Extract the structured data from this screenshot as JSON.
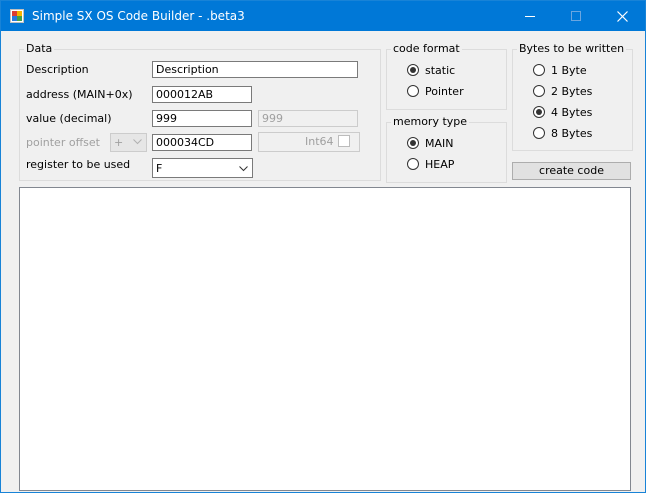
{
  "window": {
    "title": "Simple SX OS Code Builder - .beta3"
  },
  "data_group": {
    "title": "Data",
    "description_label": "Description",
    "description_value": "Description",
    "address_label": "address (MAIN+0x)",
    "address_value": "000012AB",
    "value_label": "value (decimal)",
    "value_value": "999",
    "value_secondary": "999",
    "pointer_offset_label": "pointer offset",
    "pointer_sign": "+",
    "pointer_offset_value": "000034CD",
    "int64_label": "Int64",
    "register_label": "register to be used",
    "register_value": "F"
  },
  "code_format": {
    "title": "code format",
    "options": [
      "static",
      "Pointer"
    ],
    "selected": "static"
  },
  "memory_type": {
    "title": "memory type",
    "options": [
      "MAIN",
      "HEAP"
    ],
    "selected": "MAIN"
  },
  "bytes_group": {
    "title": "Bytes to be written",
    "options": [
      "1 Byte",
      "2 Bytes",
      "4 Bytes",
      "8 Bytes"
    ],
    "selected": "4 Bytes"
  },
  "create_button": "create code",
  "output_text": "",
  "colors": {
    "titlebar": "#0078d7",
    "background": "#f0f0f0"
  }
}
